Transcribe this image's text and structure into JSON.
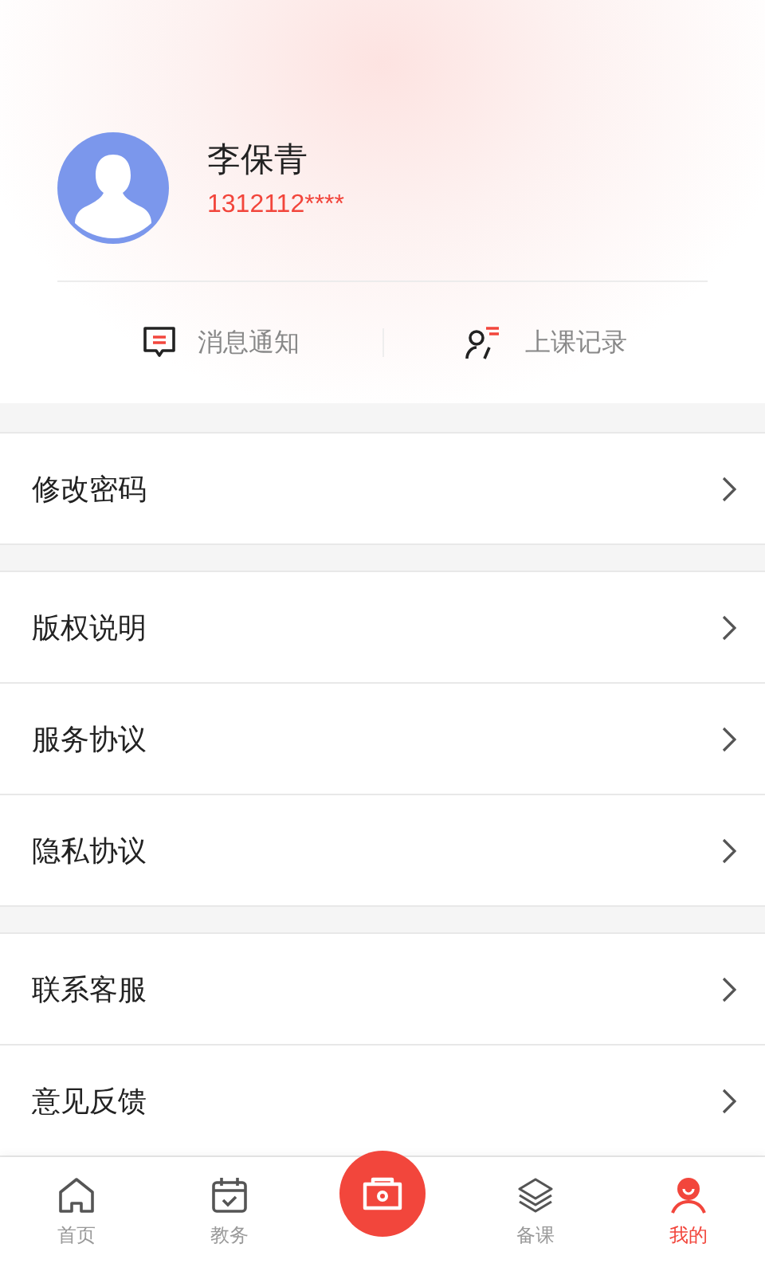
{
  "profile": {
    "name": "李保青",
    "phone": "1312112****"
  },
  "quick_links": [
    {
      "kind": "message",
      "label": "消息通知"
    },
    {
      "kind": "record",
      "label": "上课记录"
    }
  ],
  "menu_groups": [
    [
      {
        "label": "修改密码"
      }
    ],
    [
      {
        "label": "版权说明"
      },
      {
        "label": "服务协议"
      },
      {
        "label": "隐私协议"
      }
    ],
    [
      {
        "label": "联系客服"
      },
      {
        "label": "意见反馈"
      }
    ]
  ],
  "tabs": [
    {
      "kind": "home",
      "label": "首页",
      "selected": false
    },
    {
      "kind": "calendar",
      "label": "教务",
      "selected": false
    },
    {
      "kind": "camera",
      "selected": false
    },
    {
      "kind": "layers",
      "label": "备课",
      "selected": false
    },
    {
      "kind": "person",
      "label": "我的",
      "selected": true
    }
  ]
}
